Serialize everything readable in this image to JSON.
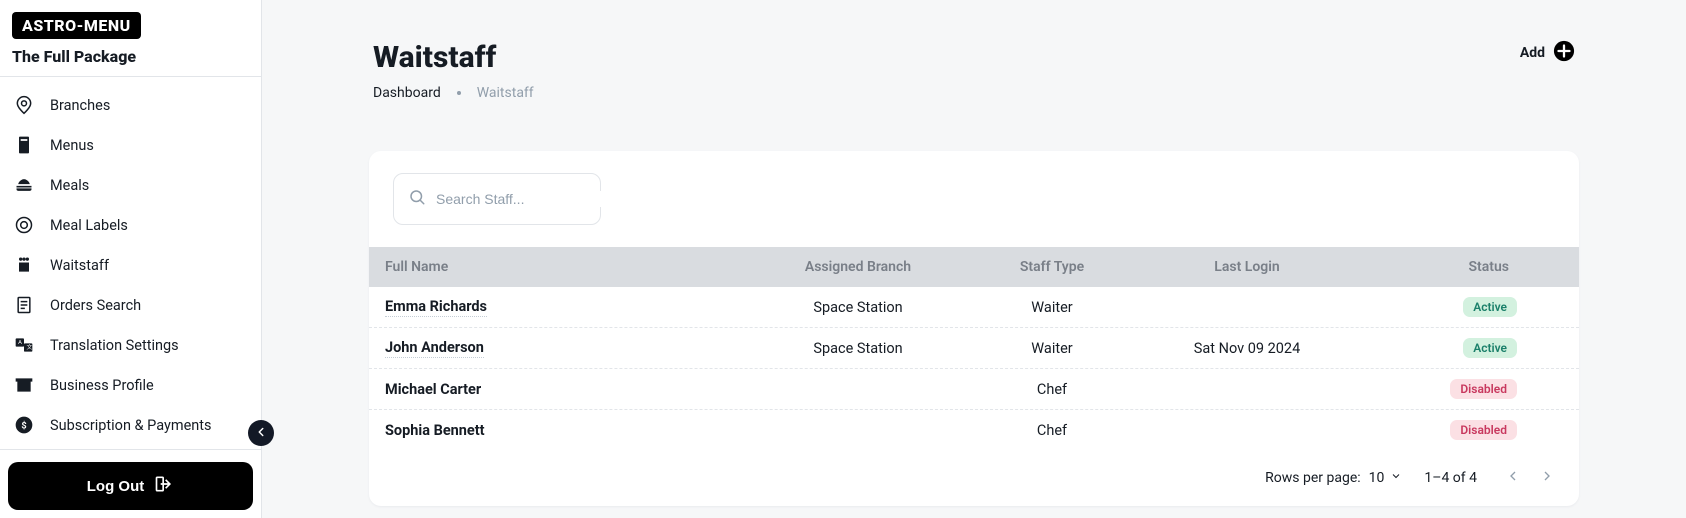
{
  "brand": "ASTRO-MENU",
  "package_name": "The Full Package",
  "sidebar": {
    "items": [
      {
        "label": "Branches"
      },
      {
        "label": "Menus"
      },
      {
        "label": "Meals"
      },
      {
        "label": "Meal Labels"
      },
      {
        "label": "Waitstaff"
      },
      {
        "label": "Orders Search"
      },
      {
        "label": "Translation Settings"
      },
      {
        "label": "Business Profile"
      },
      {
        "label": "Subscription & Payments"
      }
    ],
    "logout_label": "Log Out"
  },
  "header": {
    "title": "Waitstaff",
    "breadcrumb": {
      "root": "Dashboard",
      "current": "Waitstaff"
    },
    "add_label": "Add"
  },
  "search": {
    "placeholder": "Search Staff..."
  },
  "table": {
    "columns": {
      "name": "Full Name",
      "branch": "Assigned Branch",
      "type": "Staff Type",
      "login": "Last Login",
      "status": "Status"
    },
    "rows": [
      {
        "name": "Emma Richards",
        "branch": "Space Station",
        "type": "Waiter",
        "login": "",
        "status": "Active"
      },
      {
        "name": "John Anderson",
        "branch": "Space Station",
        "type": "Waiter",
        "login": "Sat Nov 09 2024",
        "status": "Active"
      },
      {
        "name": "Michael Carter",
        "branch": "",
        "type": "Chef",
        "login": "",
        "status": "Disabled"
      },
      {
        "name": "Sophia Bennett",
        "branch": "",
        "type": "Chef",
        "login": "",
        "status": "Disabled"
      }
    ]
  },
  "footer": {
    "rows_per_page_label": "Rows per page:",
    "rows_per_page_value": "10",
    "range": "1–4 of 4"
  },
  "status_styles": {
    "Active": "badge-active",
    "Disabled": "badge-disabled"
  }
}
